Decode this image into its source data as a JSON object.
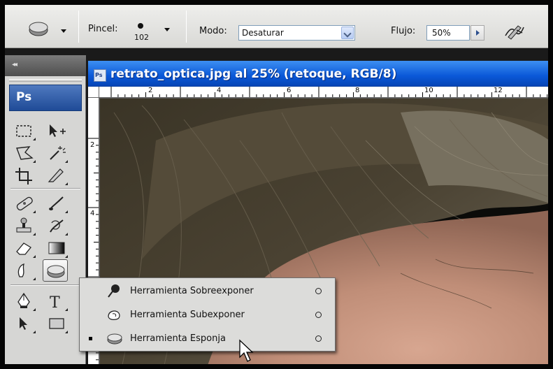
{
  "options_bar": {
    "brush_label": "Pincel:",
    "brush_size": "102",
    "mode_label": "Modo:",
    "mode_value": "Desaturar",
    "flow_label": "Flujo:",
    "flow_value": "50%"
  },
  "toolbox": {
    "collapse_glyph": "◂◂",
    "logo_text": "Ps"
  },
  "document": {
    "title": "retrato_optica.jpg al 25% (retoque, RGB/8)",
    "file_badge": "Ps",
    "ruler_h_labels": [
      "2",
      "4",
      "6",
      "8",
      "10",
      "12"
    ],
    "ruler_v_labels": [
      "2",
      "4"
    ]
  },
  "flyout": {
    "items": [
      {
        "label": "Herramienta Sobreexponer",
        "selected": false,
        "icon": "dodge-icon"
      },
      {
        "label": "Herramienta Subexponer",
        "selected": false,
        "icon": "burn-icon"
      },
      {
        "label": "Herramienta Esponja",
        "selected": true,
        "icon": "sponge-icon"
      }
    ]
  },
  "colors": {
    "titlebar_blue": "#0a58d8",
    "toolbox_bg": "#d6d6d4",
    "logo_blue": "#1f4b97"
  }
}
